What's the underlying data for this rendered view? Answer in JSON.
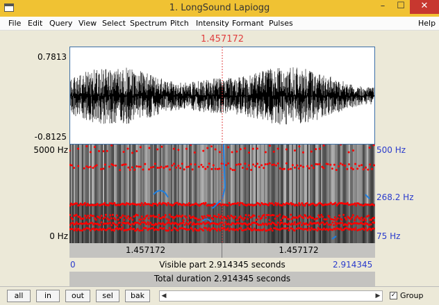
{
  "window": {
    "title": "1. LongSound Lapiogg",
    "minimize": "–",
    "maximize": "☐",
    "close": "✕"
  },
  "menu": [
    "File",
    "Edit",
    "Query",
    "View",
    "Select",
    "Spectrum",
    "Pitch",
    "Intensity",
    "Formant",
    "Pulses",
    "Help"
  ],
  "cursor_time": "1.457172",
  "waveform": {
    "y_top": "0.7813",
    "y_bottom": "-0.8125"
  },
  "spectrogram": {
    "y_top": "5000 Hz",
    "y_bottom": "0 Hz"
  },
  "pitch_axis": {
    "top": "500 Hz",
    "mid": "268.2 Hz",
    "bottom": "75 Hz"
  },
  "selection_row": {
    "left": "1.457172",
    "right": "1.457172"
  },
  "visible_row": {
    "start": "0",
    "label": "Visible part 2.914345 seconds",
    "end": "2.914345"
  },
  "total_row": {
    "label": "Total duration 2.914345 seconds"
  },
  "buttons": {
    "all": "all",
    "in": "in",
    "out": "out",
    "sel": "sel",
    "bak": "bak"
  },
  "scroll": {
    "left": "◀",
    "right": "▶"
  },
  "group": {
    "label": "Group",
    "checked": true,
    "check_mark": "✓"
  },
  "colors": {
    "titlebar": "#f0c233",
    "cursor": "#e04040",
    "formant": "#ff0000",
    "pitch": "#1e7fe0",
    "axis_blue": "#2a3bcc"
  }
}
